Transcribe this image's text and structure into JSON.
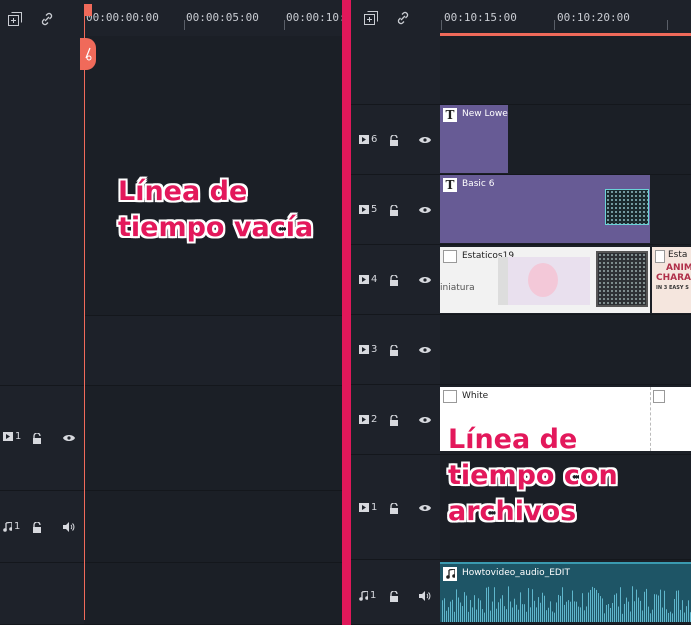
{
  "left_panel": {
    "ruler": {
      "times": [
        "00:00:00:00",
        "00:00:05:00",
        "00:00:10:0"
      ]
    },
    "toolbar": {
      "add_track_icon": "add-track-icon",
      "link_icon": "link-icon"
    },
    "tracks": [
      {
        "id": "video-1",
        "label": "1",
        "kind": "video"
      },
      {
        "id": "audio-1",
        "label": "1",
        "kind": "audio"
      }
    ],
    "annotation": {
      "line1": "Línea de",
      "line2": "tiempo vacía"
    }
  },
  "right_panel": {
    "ruler": {
      "times": [
        "00:10:15:00",
        "00:10:20:00"
      ]
    },
    "toolbar": {
      "add_track_icon": "add-track-icon",
      "link_icon": "link-icon"
    },
    "tracks": [
      {
        "id": "video-6",
        "label": "6"
      },
      {
        "id": "video-5",
        "label": "5"
      },
      {
        "id": "video-4",
        "label": "4"
      },
      {
        "id": "video-3",
        "label": "3"
      },
      {
        "id": "video-2",
        "label": "2"
      },
      {
        "id": "video-1",
        "label": "1"
      },
      {
        "id": "audio-1",
        "label": "1"
      }
    ],
    "clips": {
      "new_lower": "New Lowe",
      "basic6": "Basic 6",
      "estaticos": "Estaticos19",
      "estaticos_trunc": "Esta",
      "miniatura": "iniatura",
      "animated_lines": [
        "ANIM",
        "CHARAC",
        "IN 3 EASY S"
      ],
      "white": "White",
      "audio": "Howtovideo_audio_EDIT"
    },
    "annotation": {
      "line1": "Línea de",
      "line2": "tiempo con",
      "line3": "archivos"
    }
  },
  "colors": {
    "divider": "#e0185a",
    "playhead": "#f06a5a",
    "title_clip": "#675b95",
    "audio_clip": "#2a6f80",
    "annotation_text": "#e3185b"
  }
}
